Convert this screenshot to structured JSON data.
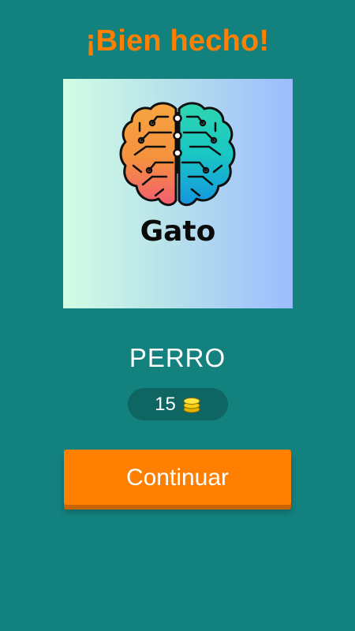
{
  "header": {
    "title": "¡Bien hecho!"
  },
  "card": {
    "word": "Gato",
    "logo_icon": "brain-icon"
  },
  "answer": {
    "word": "PERRO"
  },
  "coins": {
    "count": "15",
    "icon": "coins-icon"
  },
  "actions": {
    "continue_label": "Continuar"
  },
  "colors": {
    "background": "#13827f",
    "accent": "#ff7f00",
    "pill": "#0e6562"
  }
}
